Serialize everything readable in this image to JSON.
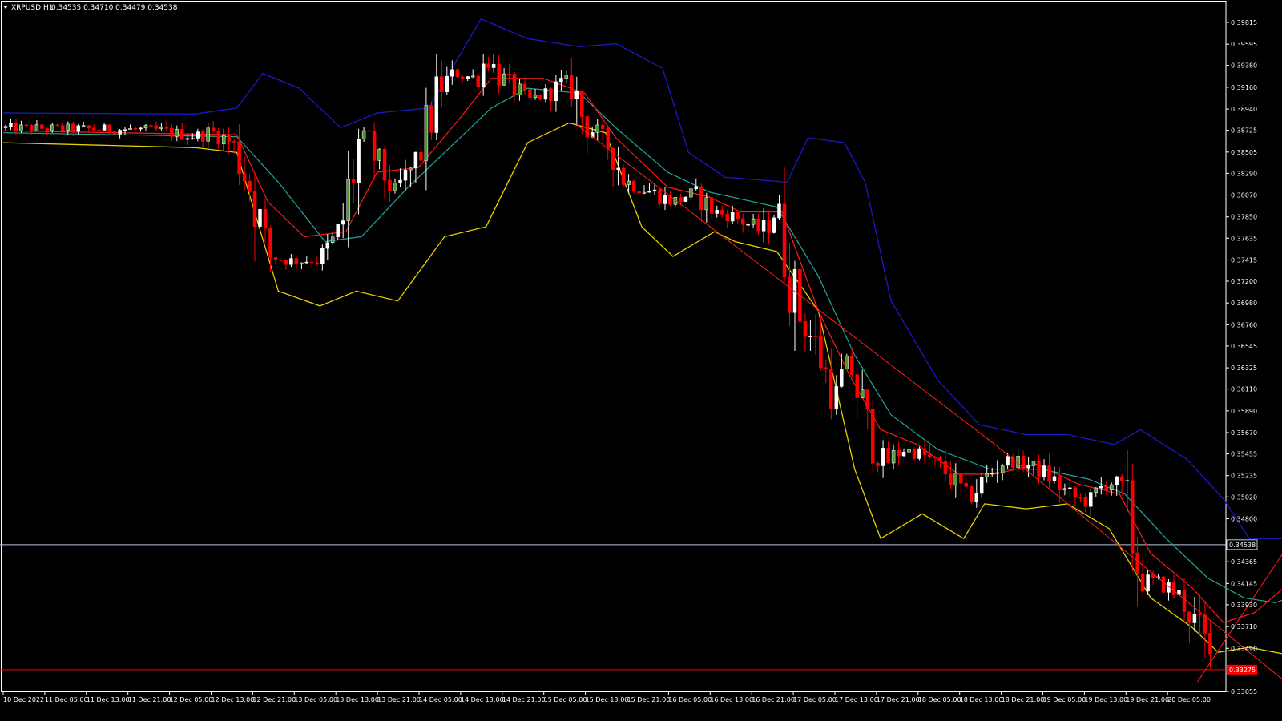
{
  "window": {
    "symbol_label": "XRPUSD,H1",
    "ohlc_label": "0.34535 0.34710 0.34479 0.34538"
  },
  "colors": {
    "background": "#000000",
    "bull_candle": "#ffffff",
    "bull_candle_alt": "#4f9a2e",
    "bear_candle": "#ff0000",
    "bb_upper": "#1a1ac8",
    "bb_lower": "#e8d000",
    "ma_fast": "#ff1a1a",
    "ma_slow": "#1fa59a",
    "trendline": "#ff2020",
    "price_line": "#b8c8e0",
    "support_line": "#ff0000"
  },
  "chart_data": {
    "type": "candlestick",
    "y_ticks": [
      "0.39815",
      "0.39595",
      "0.39380",
      "0.39160",
      "0.38940",
      "0.38725",
      "0.38505",
      "0.38290",
      "0.38070",
      "0.37850",
      "0.37635",
      "0.37415",
      "0.37200",
      "0.36980",
      "0.36760",
      "0.36545",
      "0.36325",
      "0.36110",
      "0.35890",
      "0.35670",
      "0.35455",
      "0.35235",
      "0.35020",
      "0.34800",
      "0.34365",
      "0.34145",
      "0.33930",
      "0.33710",
      "0.33490",
      "0.33055"
    ],
    "x_ticks": [
      "10 Dec 2022",
      "11 Dec 05:00",
      "11 Dec 13:00",
      "11 Dec 21:00",
      "12 Dec 05:00",
      "12 Dec 13:00",
      "12 Dec 21:00",
      "13 Dec 05:00",
      "13 Dec 13:00",
      "13 Dec 21:00",
      "14 Dec 05:00",
      "14 Dec 13:00",
      "14 Dec 21:00",
      "15 Dec 05:00",
      "15 Dec 13:00",
      "15 Dec 21:00",
      "16 Dec 05:00",
      "16 Dec 13:00",
      "16 Dec 21:00",
      "17 Dec 05:00",
      "17 Dec 13:00",
      "17 Dec 21:00",
      "18 Dec 05:00",
      "18 Dec 13:00",
      "18 Dec 21:00",
      "19 Dec 05:00",
      "19 Dec 13:00",
      "19 Dec 21:00",
      "20 Dec 05:00"
    ],
    "current_price": 0.34538,
    "current_price_label": "0.34538",
    "support_price": 0.33275,
    "support_label": "0.33275",
    "close_path": [
      [
        "2022-12-10 00:00",
        0.3875
      ],
      [
        "2022-12-11 05:00",
        0.3873
      ],
      [
        "2022-12-11 13:00",
        0.3866
      ],
      [
        "2022-12-11 16:00",
        0.3872
      ],
      [
        "2022-12-11 20:00",
        0.386
      ],
      [
        "2022-12-12 00:00",
        0.381
      ],
      [
        "2022-12-12 03:00",
        0.3745
      ],
      [
        "2022-12-12 08:00",
        0.374
      ],
      [
        "2022-12-12 13:00",
        0.3742
      ],
      [
        "2022-12-12 17:00",
        0.377
      ],
      [
        "2022-12-12 19:00",
        0.382
      ],
      [
        "2022-12-12 21:00",
        0.3872
      ],
      [
        "2022-12-13 00:00",
        0.384
      ],
      [
        "2022-12-13 03:00",
        0.3812
      ],
      [
        "2022-12-13 05:00",
        0.382
      ],
      [
        "2022-12-13 08:00",
        0.3845
      ],
      [
        "2022-12-13 12:00",
        0.3915
      ],
      [
        "2022-12-13 15:00",
        0.393
      ],
      [
        "2022-12-13 19:00",
        0.3925
      ],
      [
        "2022-12-13 21:00",
        0.3945
      ],
      [
        "2022-12-14 00:00",
        0.3925
      ],
      [
        "2022-12-14 05:00",
        0.3903
      ],
      [
        "2022-12-14 09:00",
        0.391
      ],
      [
        "2022-12-14 13:00",
        0.3925
      ],
      [
        "2022-12-14 16:00",
        0.388
      ],
      [
        "2022-12-14 21:00",
        0.3855
      ],
      [
        "2022-12-15 00:00",
        0.382
      ],
      [
        "2022-12-15 05:00",
        0.381
      ],
      [
        "2022-12-15 09:00",
        0.38
      ],
      [
        "2022-12-15 13:00",
        0.381
      ],
      [
        "2022-12-15 17:00",
        0.379
      ],
      [
        "2022-12-15 21:00",
        0.3785
      ],
      [
        "2022-12-16 02:00",
        0.377
      ],
      [
        "2022-12-16 05:00",
        0.379
      ],
      [
        "2022-12-16 09:00",
        0.369
      ],
      [
        "2022-12-16 13:00",
        0.365
      ],
      [
        "2022-12-16 16:00",
        0.36
      ],
      [
        "2022-12-16 19:00",
        0.364
      ],
      [
        "2022-12-16 23:00",
        0.356
      ],
      [
        "2022-12-17 02:00",
        0.3535
      ],
      [
        "2022-12-17 05:00",
        0.355
      ],
      [
        "2022-12-17 09:00",
        0.3545
      ],
      [
        "2022-12-17 13:00",
        0.353
      ],
      [
        "2022-12-17 18:00",
        0.35
      ],
      [
        "2022-12-17 21:00",
        0.352
      ],
      [
        "2022-12-18 01:00",
        0.354
      ],
      [
        "2022-12-18 05:00",
        0.3535
      ],
      [
        "2022-12-18 09:00",
        0.3525
      ],
      [
        "2022-12-18 13:00",
        0.3505
      ],
      [
        "2022-12-18 17:00",
        0.3495
      ],
      [
        "2022-12-18 21:00",
        0.352
      ],
      [
        "2022-12-19 00:00",
        0.35
      ],
      [
        "2022-12-19 03:00",
        0.342
      ],
      [
        "2022-12-19 07:00",
        0.3415
      ],
      [
        "2022-12-19 11:00",
        0.34
      ],
      [
        "2022-12-19 15:00",
        0.336
      ],
      [
        "2022-12-19 17:00",
        0.333
      ],
      [
        "2022-12-19 20:00",
        0.3385
      ],
      [
        "2022-12-19 23:00",
        0.3375
      ],
      [
        "2022-12-20 02:00",
        0.339
      ],
      [
        "2022-12-20 05:00",
        0.344
      ],
      [
        "2022-12-20 08:00",
        0.343
      ],
      [
        "2022-12-20 10:00",
        0.3454
      ]
    ],
    "bb_upper": [
      [
        "2022-12-10 00:00",
        0.389
      ],
      [
        "2022-12-11 13:00",
        0.3889
      ],
      [
        "2022-12-11 21:00",
        0.3895
      ],
      [
        "2022-12-12 02:00",
        0.393
      ],
      [
        "2022-12-12 09:00",
        0.3915
      ],
      [
        "2022-12-12 17:00",
        0.3875
      ],
      [
        "2022-12-13 00:00",
        0.389
      ],
      [
        "2022-12-13 10:00",
        0.3895
      ],
      [
        "2022-12-13 20:00",
        0.3985
      ],
      [
        "2022-12-14 05:00",
        0.3965
      ],
      [
        "2022-12-14 15:00",
        0.3957
      ],
      [
        "2022-12-14 22:00",
        0.396
      ],
      [
        "2022-12-15 07:00",
        0.3935
      ],
      [
        "2022-12-15 12:00",
        0.385
      ],
      [
        "2022-12-15 19:00",
        0.3825
      ],
      [
        "2022-12-16 07:00",
        0.382
      ],
      [
        "2022-12-16 11:00",
        0.3865
      ],
      [
        "2022-12-16 18:00",
        0.386
      ],
      [
        "2022-12-16 22:00",
        0.382
      ],
      [
        "2022-12-17 03:00",
        0.37
      ],
      [
        "2022-12-17 12:00",
        0.362
      ],
      [
        "2022-12-17 20:00",
        0.3575
      ],
      [
        "2022-12-18 05:00",
        0.3565
      ],
      [
        "2022-12-18 13:00",
        0.3565
      ],
      [
        "2022-12-18 22:00",
        0.3555
      ],
      [
        "2022-12-19 03:00",
        0.357
      ],
      [
        "2022-12-19 12:00",
        0.354
      ],
      [
        "2022-12-19 19:00",
        0.35
      ],
      [
        "2022-12-20 00:00",
        0.346
      ],
      [
        "2022-12-20 10:00",
        0.346
      ]
    ],
    "bb_lower": [
      [
        "2022-12-10 00:00",
        0.386
      ],
      [
        "2022-12-11 13:00",
        0.3855
      ],
      [
        "2022-12-11 21:00",
        0.385
      ],
      [
        "2022-12-12 05:00",
        0.371
      ],
      [
        "2022-12-12 13:00",
        0.3695
      ],
      [
        "2022-12-12 20:00",
        0.371
      ],
      [
        "2022-12-13 04:00",
        0.37
      ],
      [
        "2022-12-13 13:00",
        0.3765
      ],
      [
        "2022-12-13 21:00",
        0.3775
      ],
      [
        "2022-12-14 05:00",
        0.386
      ],
      [
        "2022-12-14 13:00",
        0.388
      ],
      [
        "2022-12-14 20:00",
        0.387
      ],
      [
        "2022-12-15 03:00",
        0.3775
      ],
      [
        "2022-12-15 09:00",
        0.3745
      ],
      [
        "2022-12-15 17:00",
        0.377
      ],
      [
        "2022-12-15 21:00",
        0.376
      ],
      [
        "2022-12-16 05:00",
        0.375
      ],
      [
        "2022-12-16 13:00",
        0.369
      ],
      [
        "2022-12-16 20:00",
        0.353
      ],
      [
        "2022-12-17 01:00",
        0.346
      ],
      [
        "2022-12-17 09:00",
        0.3485
      ],
      [
        "2022-12-17 17:00",
        0.346
      ],
      [
        "2022-12-17 21:00",
        0.3495
      ],
      [
        "2022-12-18 05:00",
        0.349
      ],
      [
        "2022-12-18 13:00",
        0.3495
      ],
      [
        "2022-12-18 21:00",
        0.347
      ],
      [
        "2022-12-19 05:00",
        0.34
      ],
      [
        "2022-12-19 13:00",
        0.337
      ],
      [
        "2022-12-19 18:00",
        0.3345
      ],
      [
        "2022-12-20 00:00",
        0.335
      ],
      [
        "2022-12-20 10:00",
        0.334
      ]
    ],
    "ma_fast": [
      [
        "2022-12-10 00:00",
        0.3872
      ],
      [
        "2022-12-11 21:00",
        0.3868
      ],
      [
        "2022-12-12 03:00",
        0.38
      ],
      [
        "2022-12-12 10:00",
        0.3765
      ],
      [
        "2022-12-12 18:00",
        0.377
      ],
      [
        "2022-12-13 00:00",
        0.383
      ],
      [
        "2022-12-13 08:00",
        0.3835
      ],
      [
        "2022-12-13 16:00",
        0.3885
      ],
      [
        "2022-12-13 22:00",
        0.3925
      ],
      [
        "2022-12-14 08:00",
        0.3925
      ],
      [
        "2022-12-14 16:00",
        0.391
      ],
      [
        "2022-12-14 22:00",
        0.3865
      ],
      [
        "2022-12-15 08:00",
        0.3815
      ],
      [
        "2022-12-15 16:00",
        0.3805
      ],
      [
        "2022-12-15 22:00",
        0.379
      ],
      [
        "2022-12-16 06:00",
        0.379
      ],
      [
        "2022-12-16 13:00",
        0.369
      ],
      [
        "2022-12-16 19:00",
        0.3625
      ],
      [
        "2022-12-17 01:00",
        0.357
      ],
      [
        "2022-12-17 08:00",
        0.3555
      ],
      [
        "2022-12-17 16:00",
        0.3525
      ],
      [
        "2022-12-17 23:00",
        0.3525
      ],
      [
        "2022-12-18 07:00",
        0.3535
      ],
      [
        "2022-12-18 15:00",
        0.3515
      ],
      [
        "2022-12-18 23:00",
        0.3505
      ],
      [
        "2022-12-19 05:00",
        0.3445
      ],
      [
        "2022-12-19 13:00",
        0.341
      ],
      [
        "2022-12-19 19:00",
        0.3375
      ],
      [
        "2022-12-20 01:00",
        0.3385
      ],
      [
        "2022-12-20 10:00",
        0.3425
      ]
    ],
    "ma_slow": [
      [
        "2022-12-10 00:00",
        0.387
      ],
      [
        "2022-12-11 21:00",
        0.3866
      ],
      [
        "2022-12-12 05:00",
        0.382
      ],
      [
        "2022-12-12 14:00",
        0.376
      ],
      [
        "2022-12-12 21:00",
        0.3765
      ],
      [
        "2022-12-13 06:00",
        0.3815
      ],
      [
        "2022-12-13 15:00",
        0.386
      ],
      [
        "2022-12-13 22:00",
        0.3895
      ],
      [
        "2022-12-14 05:00",
        0.3915
      ],
      [
        "2022-12-14 15:00",
        0.391
      ],
      [
        "2022-12-14 22:00",
        0.3875
      ],
      [
        "2022-12-15 08:00",
        0.383
      ],
      [
        "2022-12-15 16:00",
        0.381
      ],
      [
        "2022-12-16 05:00",
        0.3795
      ],
      [
        "2022-12-16 13:00",
        0.3725
      ],
      [
        "2022-12-16 20:00",
        0.3645
      ],
      [
        "2022-12-17 03:00",
        0.3585
      ],
      [
        "2022-12-17 12:00",
        0.355
      ],
      [
        "2022-12-17 22:00",
        0.353
      ],
      [
        "2022-12-18 08:00",
        0.353
      ],
      [
        "2022-12-18 17:00",
        0.352
      ],
      [
        "2022-12-19 00:00",
        0.3505
      ],
      [
        "2022-12-19 08:00",
        0.346
      ],
      [
        "2022-12-19 16:00",
        0.342
      ],
      [
        "2022-12-19 23:00",
        0.34
      ],
      [
        "2022-12-20 05:00",
        0.3395
      ],
      [
        "2022-12-20 10:00",
        0.3405
      ]
    ],
    "trendlines": [
      [
        [
          "2022-12-14 14:00",
          0.388
        ],
        [
          "2022-12-17 23:00",
          0.3555
        ],
        [
          "2022-12-20 10:30",
          0.33
        ]
      ],
      [
        [
          "2022-12-19 14:00",
          0.3315
        ],
        [
          "2022-12-20 11:30",
          0.3485
        ]
      ]
    ]
  }
}
